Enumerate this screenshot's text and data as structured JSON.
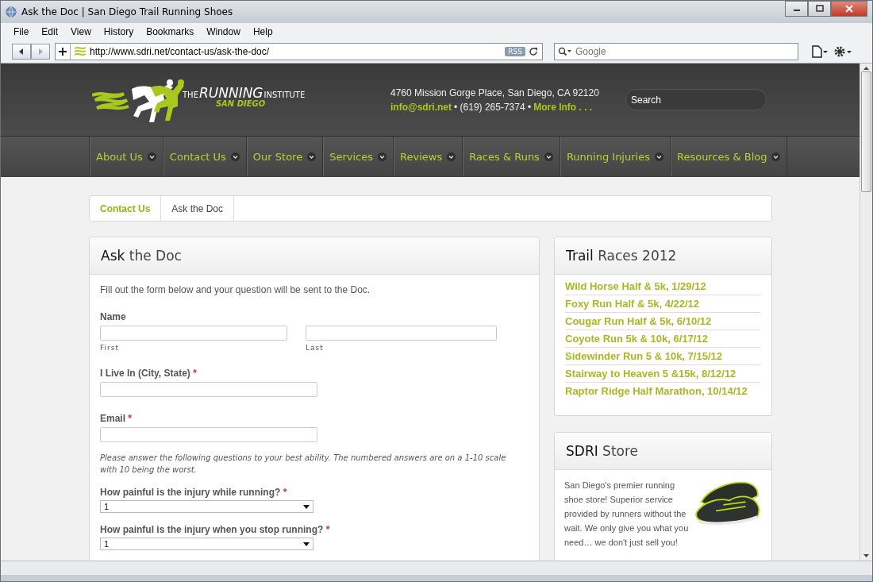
{
  "window": {
    "title": "Ask the Doc | San Diego Trail Running Shoes"
  },
  "menu": [
    "File",
    "Edit",
    "View",
    "History",
    "Bookmarks",
    "Window",
    "Help"
  ],
  "address_bar": {
    "url": "http://www.sdri.net/contact-us/ask-the-doc/",
    "rss": "RSS"
  },
  "search_bar": {
    "placeholder": "Google"
  },
  "site": {
    "logo": {
      "the": "THE",
      "running": "RUNNING",
      "institute": "INSTITUTE",
      "city": "SAN DIEGO"
    },
    "address": "4760 Mission Gorge Place, San Diego, CA 92120",
    "email": "info@sdri.net",
    "phone": "• (619) 265-7374 •",
    "more": "More Info . . .",
    "search": {
      "placeholder": "Search"
    }
  },
  "nav": [
    "About Us",
    "Contact Us",
    "Our Store",
    "Services",
    "Reviews",
    "Races & Runs",
    "Running Injuries",
    "Resources & Blog"
  ],
  "breadcrumb": [
    {
      "label": "Contact Us",
      "selected": false
    },
    {
      "label": "Ask the Doc",
      "selected": true
    }
  ],
  "form": {
    "title": "**Ask** the Doc",
    "intro": "Fill out the form below and your question will be sent to the Doc.",
    "name_label": "Name",
    "first": "First",
    "last": "Last",
    "city_label": "I Live In (City, State)",
    "email_label": "Email",
    "required": "*",
    "note": "Please answer the following questions to your best ability. The numbered answers are on a 1-10 scale with 10 being the worst.",
    "questions": [
      {
        "label": "How painful is the injury while running?",
        "value": "1"
      },
      {
        "label": "How painful is the injury when you stop running?",
        "value": "1"
      }
    ]
  },
  "trail_races": {
    "title": "**Trail** Races 2012",
    "items": [
      "Wild Horse Half & 5k, 1/29/12",
      "Foxy Run Half & 5k, 4/22/12",
      "Cougar Run Half & 5k, 6/10/12",
      "Coyote Run 5k & 10k, 6/17/12",
      "Sidewinder Run 5 & 10k, 7/15/12",
      "Stairway to Heaven 5 &15k, 8/12/12",
      "Raptor Ridge Half Marathon, 10/14/12"
    ]
  },
  "store": {
    "title": "**SDRI** Store",
    "text": "San Diego's premier running shoe store! Superior service provided by runners without the wait. We only give you what you need… we don't just sell you!"
  }
}
